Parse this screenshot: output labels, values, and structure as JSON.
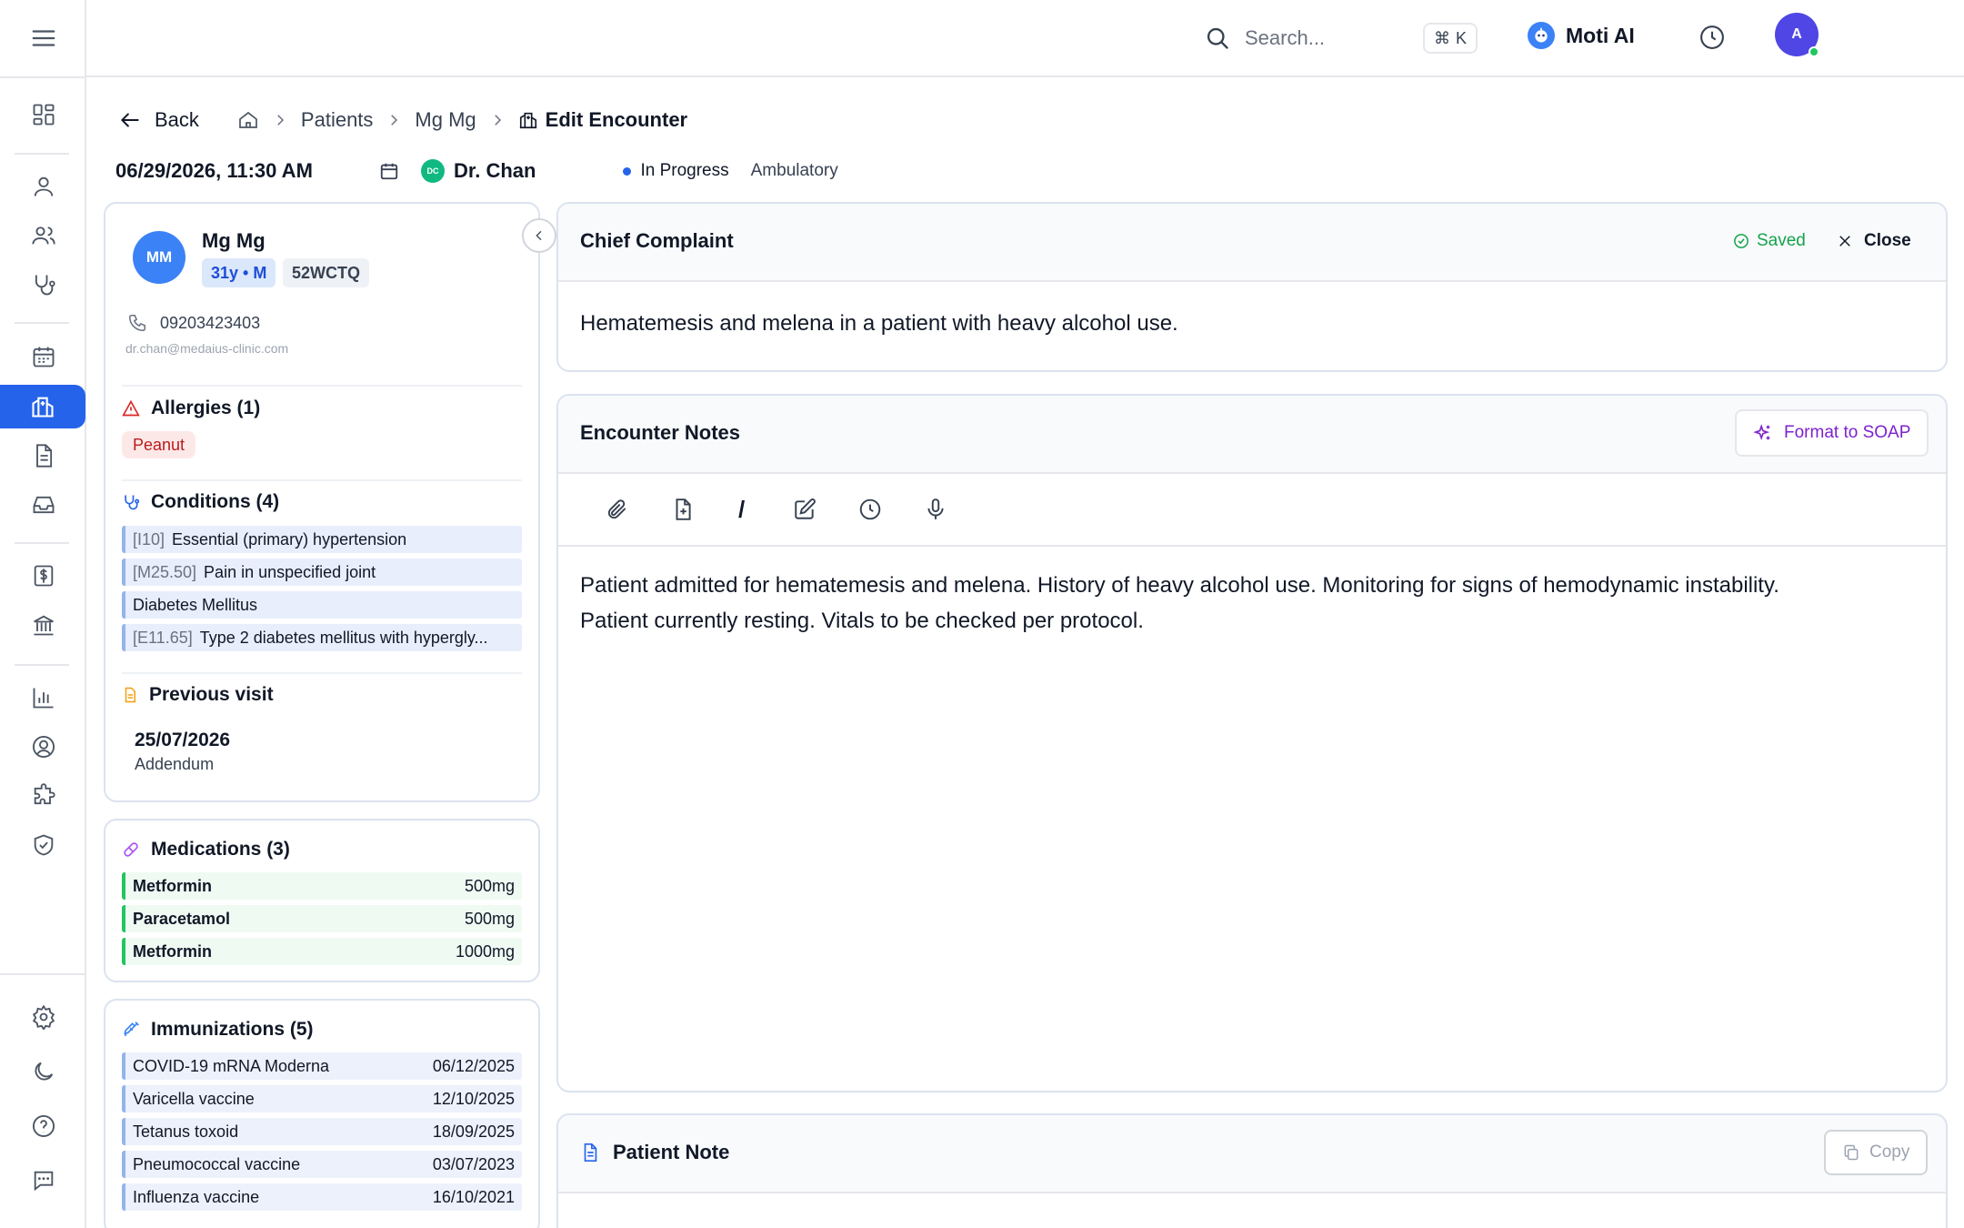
{
  "topbar": {
    "search_placeholder": "Search...",
    "shortcut_symbol": "⌘",
    "shortcut_key": "K",
    "assistant_label": "Moti AI",
    "user_initial": "A"
  },
  "breadcrumb": {
    "back_label": "Back",
    "items": [
      "Patients",
      "Mg Mg"
    ],
    "current": "Edit Encounter"
  },
  "encounter": {
    "datetime": "06/29/2026, 11:30  AM",
    "doctor_initials": "DC",
    "doctor": "Dr. Chan",
    "status": "In Progress",
    "type": "Ambulatory"
  },
  "patient": {
    "initials": "MM",
    "name": "Mg Mg",
    "age_sex": "31y • M",
    "id": "52WCTQ",
    "phone": "09203423403",
    "email": "dr.chan@medaius-clinic.com"
  },
  "allergies": {
    "title": "Allergies (1)",
    "items": [
      "Peanut"
    ]
  },
  "conditions": {
    "title": "Conditions (4)",
    "items": [
      {
        "code": "[I10]",
        "name": "Essential (primary) hypertension"
      },
      {
        "code": "[M25.50]",
        "name": "Pain in unspecified joint"
      },
      {
        "code": "",
        "name": "Diabetes Mellitus"
      },
      {
        "code": "[E11.65]",
        "name": "Type 2 diabetes mellitus with hypergly..."
      }
    ]
  },
  "previous_visit": {
    "title": "Previous visit",
    "date": "25/07/2026",
    "type": "Addendum"
  },
  "medications": {
    "title": "Medications (3)",
    "items": [
      {
        "name": "Metformin",
        "dose": "500mg"
      },
      {
        "name": "Paracetamol",
        "dose": "500mg"
      },
      {
        "name": "Metformin",
        "dose": "1000mg"
      }
    ]
  },
  "immunizations": {
    "title": "Immunizations (5)",
    "items": [
      {
        "name": "COVID-19 mRNA Moderna",
        "date": "06/12/2025"
      },
      {
        "name": "Varicella vaccine",
        "date": "12/10/2025"
      },
      {
        "name": "Tetanus toxoid",
        "date": "18/09/2025"
      },
      {
        "name": "Pneumococcal vaccine",
        "date": "03/07/2023"
      },
      {
        "name": "Influenza vaccine",
        "date": "16/10/2021"
      }
    ]
  },
  "chief_complaint": {
    "title": "Chief Complaint",
    "saved_label": "Saved",
    "close_label": "Close",
    "text": "Hematemesis and melena in a patient with heavy alcohol use."
  },
  "encounter_notes": {
    "title": "Encounter Notes",
    "soap_label": "Format to SOAP",
    "slash_tool": "/",
    "text_line1": "Patient admitted for hematemesis and melena. History of heavy alcohol use. Monitoring for signs of hemodynamic instability.",
    "text_line2": "Patient currently resting. Vitals to be checked per protocol."
  },
  "patient_note": {
    "title": "Patient Note",
    "copy_label": "Copy"
  },
  "colors": {
    "accent": "#2563eb",
    "saved": "#16a34a",
    "allergy": "#b91c1c",
    "medication_bar": "#22c55e",
    "soap": "#7e22ce"
  },
  "icons": {
    "sidebar": [
      "menu-icon",
      "dashboard-icon",
      "patient-icon",
      "users-icon",
      "stethoscope-icon",
      "calendar-icon",
      "encounters-icon",
      "document-icon",
      "inbox-icon",
      "billing-icon",
      "bank-icon",
      "chart-icon",
      "profile-icon",
      "puzzle-icon",
      "shield-icon",
      "settings-icon",
      "moon-icon",
      "help-icon",
      "chat-icon"
    ]
  }
}
